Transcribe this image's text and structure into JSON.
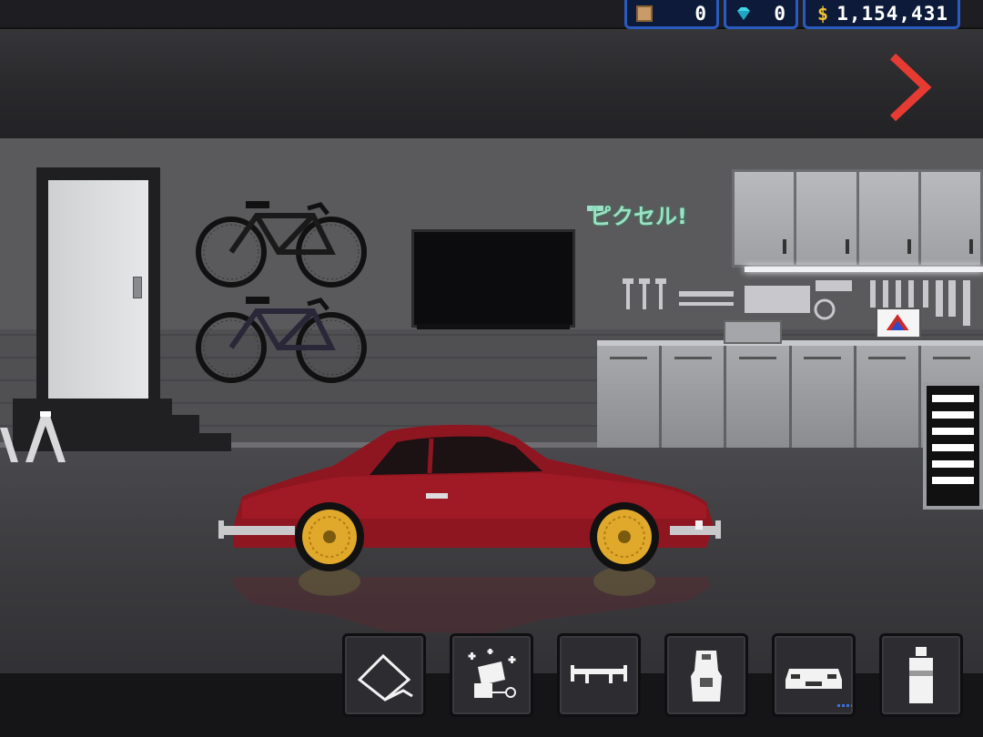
{
  "currency": {
    "boxes": "0",
    "gems": "0",
    "cash_symbol": "$",
    "cash": "1,154,431"
  },
  "scene": {
    "wall_sign": "ピクセル!"
  },
  "icons": {
    "boxes": "crate-icon",
    "gems": "diamond-icon",
    "cash": "dollar-icon",
    "next": "chevron-right-icon",
    "toolbar": [
      "wrap-icon",
      "detailing-icon",
      "spoiler-icon",
      "seat-icon",
      "body-kit-icon",
      "spray-paint-icon"
    ]
  },
  "colors": {
    "accent_blue": "#2a5bbf",
    "next_arrow": "#e63b32",
    "car_body": "#8e1620",
    "wheel_gold": "#e0a92c",
    "gem": "#3fd6e6",
    "cash_symbol": "#f2c230"
  }
}
